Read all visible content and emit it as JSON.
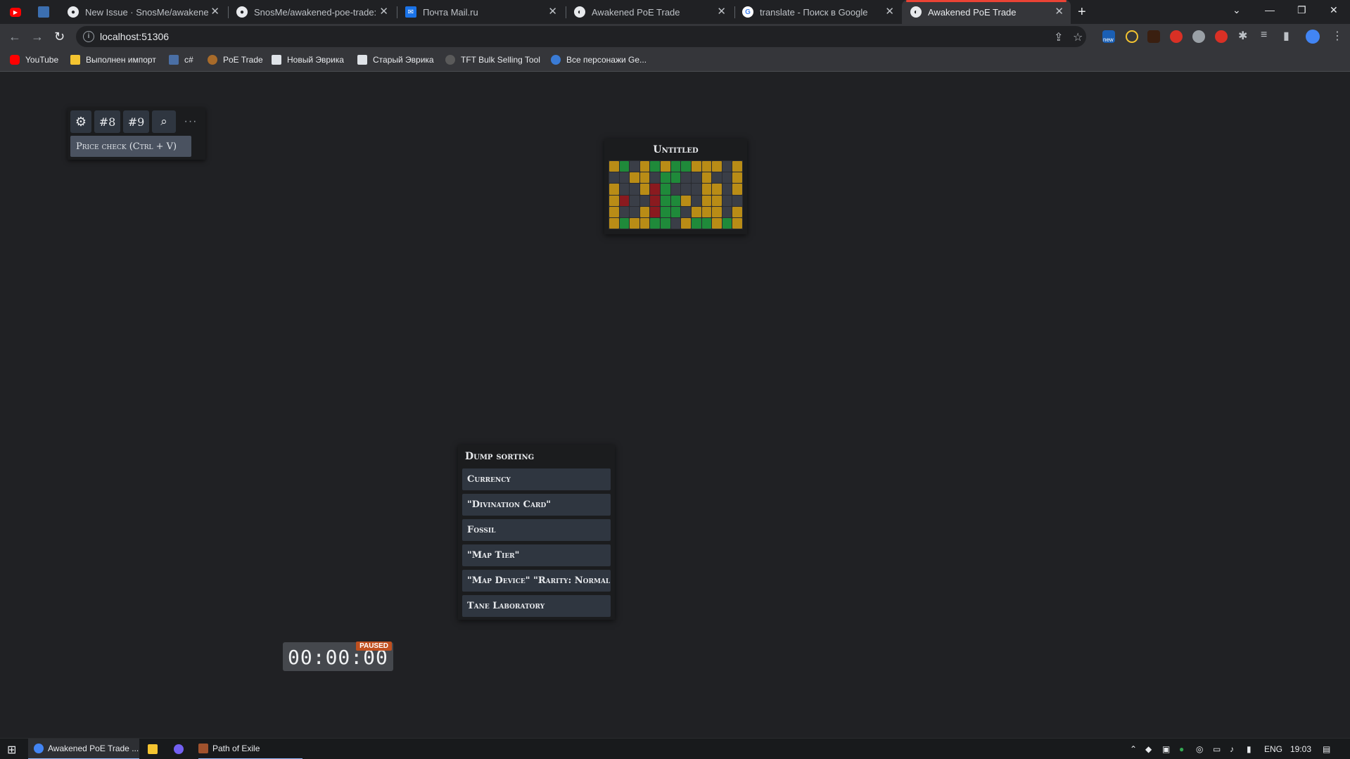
{
  "browser": {
    "tabs": [
      {
        "title": ""
      },
      {
        "title": ""
      },
      {
        "title": "New Issue · SnosMe/awakened-p"
      },
      {
        "title": "SnosMe/awakened-poe-trade: P"
      },
      {
        "title": "Почта Mail.ru"
      },
      {
        "title": "Awakened PoE Trade"
      },
      {
        "title": "translate - Поиск в Google"
      },
      {
        "title": "Awakened PoE Trade",
        "active": true
      }
    ],
    "new_tab_label": "+",
    "url": "localhost:51306",
    "bookmarks": [
      {
        "label": "YouTube"
      },
      {
        "label": "Выполнен импорт"
      },
      {
        "label": "c#"
      },
      {
        "label": "PoE Trade"
      },
      {
        "label": "Новый Эврика"
      },
      {
        "label": "Старый Эврика"
      },
      {
        "label": "TFT Bulk Selling Tool"
      },
      {
        "label": "Все персонажи Ge..."
      }
    ],
    "ext_badge": "new"
  },
  "widget_menu": {
    "btn_8": "#8",
    "btn_9": "#9",
    "more": "···",
    "price_check": "Price check (Ctrl + V)"
  },
  "stash": {
    "title": "Untitled"
  },
  "dump": {
    "title": "Dump sorting",
    "items": [
      "Currency",
      "\"Divination Card\"",
      "Fossil",
      "\"Map Tier\"",
      "\"Map Device\" \"Rarity: Normal\"",
      "Tane Laboratory"
    ]
  },
  "timer": {
    "value": "00:00:00",
    "badge": "PAUSED"
  },
  "taskbar": {
    "items": [
      {
        "label": "Awakened PoE Trade ..."
      },
      {
        "label": "Path of Exile"
      }
    ],
    "lang": "ENG",
    "time": "19:03"
  },
  "colors": {
    "accent_red": "#ea4335",
    "paused_badge": "#c0501f",
    "panel_bg": "#1b1c1e",
    "item_bg": "#2f3640",
    "grid_gold": "#b98c16",
    "grid_green": "#1f8a3a",
    "grid_red": "#8a1a1f",
    "grid_dark": "#3a3e47"
  }
}
